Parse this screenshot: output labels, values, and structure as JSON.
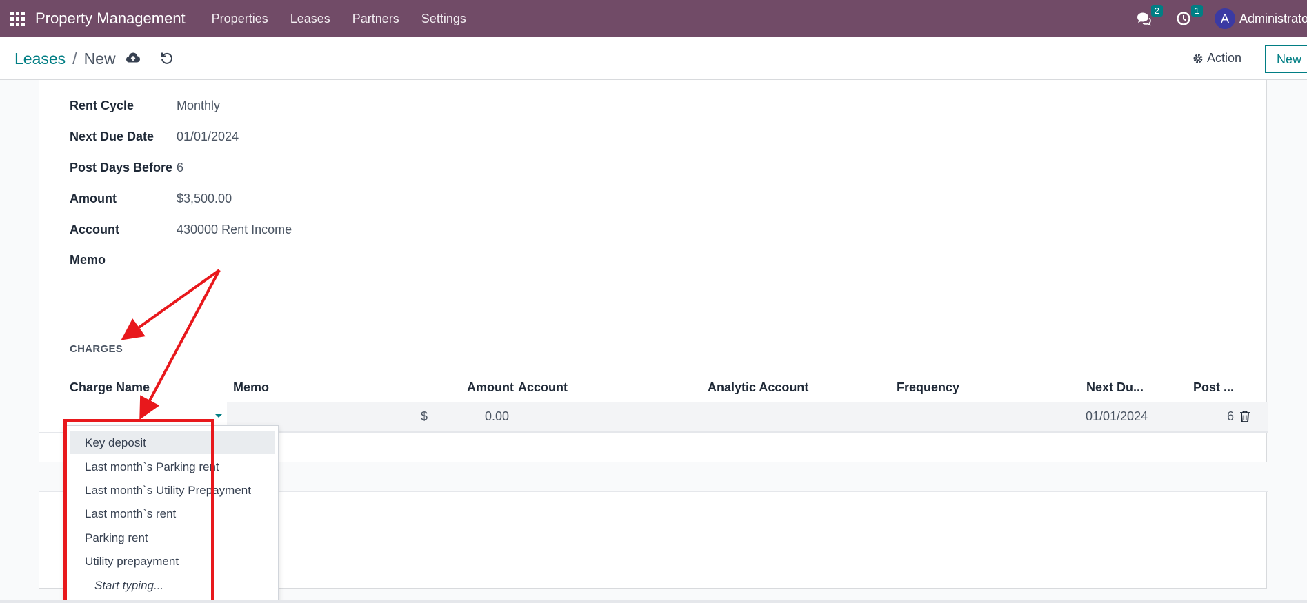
{
  "navbar": {
    "app_title": "Property Management",
    "menu": [
      "Properties",
      "Leases",
      "Partners",
      "Settings"
    ],
    "messages_count": "2",
    "activities_count": "1",
    "avatar_initial": "A",
    "user_name": "Administrator"
  },
  "control_panel": {
    "breadcrumb_parent": "Leases",
    "breadcrumb_current": "New",
    "action_label": "Action",
    "new_label": "New"
  },
  "form": {
    "fields": [
      {
        "label": "Rent Cycle",
        "value": "Monthly"
      },
      {
        "label": "Next Due Date",
        "value": "01/01/2024"
      },
      {
        "label": "Post Days Before",
        "value": "6"
      },
      {
        "label": "Amount",
        "value": "$3,500.00"
      },
      {
        "label": "Account",
        "value": "430000 Rent Income"
      },
      {
        "label": "Memo",
        "value": ""
      }
    ]
  },
  "charges": {
    "section_title": "CHARGES",
    "columns": {
      "charge_name": "Charge Name",
      "memo": "Memo",
      "amount": "Amount",
      "account": "Account",
      "analytic_account": "Analytic Account",
      "frequency": "Frequency",
      "next_due": "Next Du...",
      "post": "Post ..."
    },
    "edit_row": {
      "currency": "$",
      "amount": "0.00",
      "next_due": "01/01/2024",
      "post_days": "6"
    }
  },
  "dropdown": {
    "items": [
      "Key deposit",
      "Last month`s Parking rent",
      "Last month`s Utility Prepayment",
      "Last month`s rent",
      "Parking rent",
      "Utility prepayment"
    ],
    "hint": "Start typing..."
  },
  "colors": {
    "navbar": "#714b67",
    "accent": "#017e84",
    "annotation": "#e8181c"
  }
}
